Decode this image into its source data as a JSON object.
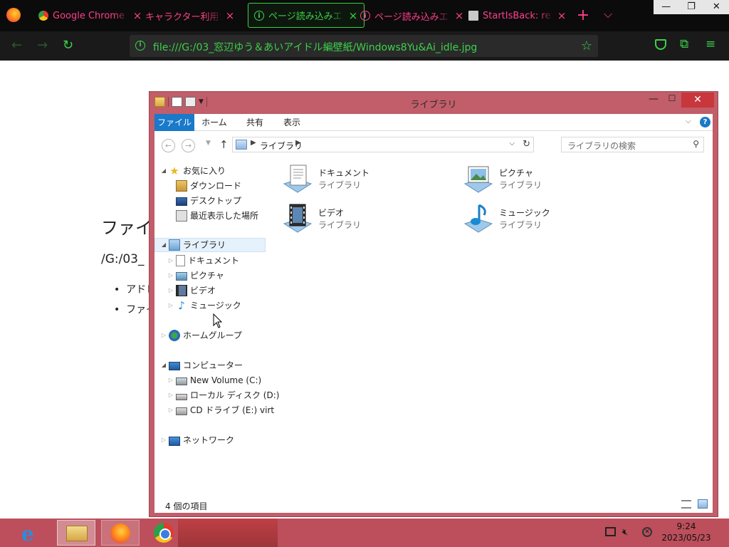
{
  "browser": {
    "tabs": [
      {
        "title": "Google Chrome",
        "icon": "chrome-icon",
        "active": false
      },
      {
        "title": "キャラクター利用ガイドライン",
        "icon": "",
        "active": false
      },
      {
        "title": "ページ読み込みエラー",
        "icon": "info-icon",
        "active": true
      },
      {
        "title": "ページ読み込みエラー",
        "icon": "info-icon",
        "active": false
      },
      {
        "title": "StartIsBack: re",
        "icon": "startisback-icon",
        "active": false
      }
    ],
    "tab_close_glyph": "×",
    "newtab_glyph": "+",
    "tablist_glyph": "⌵",
    "url": "file:///G:/03_窓辺ゆう＆あいアイドル編壁紙/Windows8Yu&Ai_idle.jpg",
    "accent_color": "#3bd14a",
    "inactive_tab_color": "#ff3f8a"
  },
  "page": {
    "heading": "ファイル",
    "path": "/G:/03_",
    "bullets": [
      "アドレス",
      "ファイル"
    ]
  },
  "explorer": {
    "title": "ライブラリ",
    "close_glyph": "✕",
    "ribbon_tabs": [
      "ファイル",
      "ホーム",
      "共有",
      "表示"
    ],
    "address_crumb": "ライブラリ",
    "search_placeholder": "ライブラリの検索",
    "nav": {
      "favorites": {
        "label": "お気に入り",
        "items": [
          "ダウンロード",
          "デスクトップ",
          "最近表示した場所"
        ]
      },
      "libraries": {
        "label": "ライブラリ",
        "items": [
          "ドキュメント",
          "ピクチャ",
          "ビデオ",
          "ミュージック"
        ]
      },
      "homegroup": "ホームグループ",
      "computer": {
        "label": "コンピューター",
        "items": [
          "New Volume (C:)",
          "ローカル ディスク (D:)",
          "CD ドライブ (E:) virt"
        ]
      },
      "network": "ネットワーク"
    },
    "libraries": [
      {
        "name": "ドキュメント",
        "type": "ライブラリ",
        "icon": "documents-library-icon"
      },
      {
        "name": "ピクチャ",
        "type": "ライブラリ",
        "icon": "pictures-library-icon"
      },
      {
        "name": "ビデオ",
        "type": "ライブラリ",
        "icon": "videos-library-icon"
      },
      {
        "name": "ミュージック",
        "type": "ライブラリ",
        "icon": "music-library-icon"
      }
    ],
    "status_text": "4 個の項目",
    "frame_color": "#c25d6a",
    "file_tab_color": "#1979ca"
  },
  "taskbar": {
    "apps": [
      "internet-explorer",
      "file-explorer",
      "firefox",
      "chrome"
    ],
    "time": "9:24",
    "date": "2023/05/23",
    "color": "#bc4f5b"
  }
}
